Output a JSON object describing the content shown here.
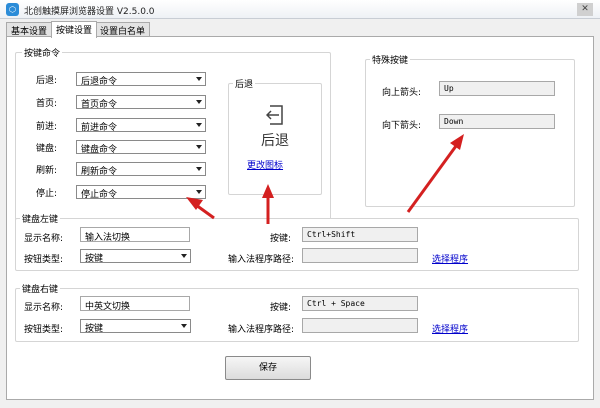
{
  "window": {
    "title": "北创触摸屏浏览器设置 V2.5.0.0",
    "icon_text": "⬡",
    "close": "✕"
  },
  "tabs": [
    {
      "label": "基本设置",
      "active": false
    },
    {
      "label": "按键设置",
      "active": true
    },
    {
      "label": "设置白名单",
      "active": false
    }
  ],
  "key_commands": {
    "title": "按键命令",
    "rows": [
      {
        "label": "后退:",
        "value": "后退命令"
      },
      {
        "label": "首页:",
        "value": "首页命令"
      },
      {
        "label": "前进:",
        "value": "前进命令"
      },
      {
        "label": "键盘:",
        "value": "键盘命令"
      },
      {
        "label": "刷新:",
        "value": "刷新命令"
      },
      {
        "label": "停止:",
        "value": "停止命令"
      }
    ]
  },
  "preview": {
    "title": "后退",
    "icon": "back-arrow-icon",
    "caption": "后退",
    "change_icon_link": "更改图标"
  },
  "special_keys": {
    "title": "特殊按键",
    "up_label": "向上箭头:",
    "up_value": "Up",
    "down_label": "向下箭头:",
    "down_value": "Down"
  },
  "keyboard_left": {
    "title": "键盘左键",
    "display_label": "显示名称:",
    "display_value": "输入法切换",
    "type_label": "按钮类型:",
    "type_value": "按键",
    "key_label": "按键:",
    "key_value": "Ctrl+Shift",
    "path_label": "输入法程序路径:",
    "path_value": "",
    "select_link": "选择程序"
  },
  "keyboard_right": {
    "title": "键盘右键",
    "display_label": "显示名称:",
    "display_value": "中英文切换",
    "type_label": "按钮类型:",
    "type_value": "按键",
    "key_label": "按键:",
    "key_value": "Ctrl + Space",
    "path_label": "输入法程序路径:",
    "path_value": "",
    "select_link": "选择程序"
  },
  "footer": {
    "save_label": "保存"
  },
  "colors": {
    "annotation_arrow": "#d42020",
    "link": "#0000cc"
  }
}
